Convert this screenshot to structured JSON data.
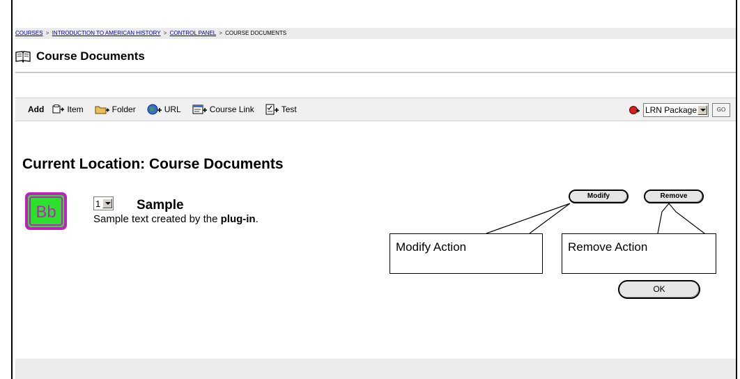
{
  "breadcrumb": {
    "items": [
      "COURSES",
      "INTRODUCTION TO AMERICAN HISTORY",
      "CONTROL PANEL",
      "COURSE DOCUMENTS"
    ],
    "separator": ">"
  },
  "header": {
    "title": "Course Documents",
    "icon": "book-icon"
  },
  "action_bar": {
    "add_label": "Add",
    "tools": [
      {
        "label": "Item",
        "icon": "item-add-icon"
      },
      {
        "label": "Folder",
        "icon": "folder-add-icon"
      },
      {
        "label": "URL",
        "icon": "globe-url-icon"
      },
      {
        "label": "Course Link",
        "icon": "course-link-icon"
      },
      {
        "label": "Test",
        "icon": "test-add-icon"
      }
    ],
    "package_select": {
      "value": "LRN Package",
      "icon": "package-add-icon"
    },
    "go_label": "GO"
  },
  "content": {
    "location_heading": "Current Location: Course Documents",
    "item": {
      "logo_text": "Bb",
      "order_value": "1",
      "title": "Sample",
      "description_prefix": "Sample text created by the ",
      "description_bold": "plug-in",
      "description_suffix": "."
    },
    "modify_button": "Modify",
    "remove_button": "Remove",
    "ok_button": "OK"
  },
  "callouts": {
    "modify": "Modify Action",
    "remove": "Remove Action"
  },
  "colors": {
    "link": "#00009c",
    "logo_green": "#2ee02e",
    "logo_magenta": "#c020c0",
    "bar_gray": "#ebebeb"
  }
}
